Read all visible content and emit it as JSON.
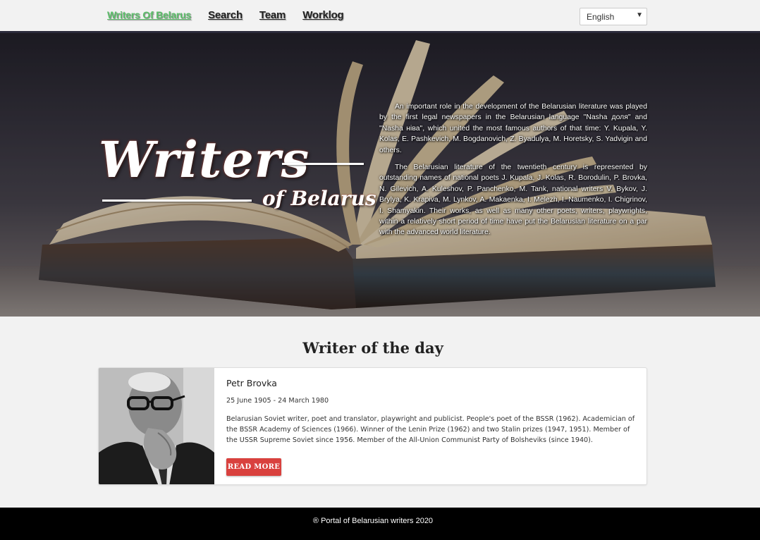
{
  "nav": {
    "brand": "Writers Of Belarus",
    "items": [
      "Search",
      "Team",
      "Worklog"
    ]
  },
  "language": {
    "selected": "English",
    "caret_icon": "chevron-down-icon"
  },
  "hero": {
    "title": "Writers",
    "subtitle": "of Belarus",
    "paragraphs": [
      "An important role in the development of the Belarusian literature was played by the first legal newspapers in the Belarusian language \"Nasha доля\" and \"Nasha нiва\", which united the most famous authors of that time: Y. Kupala, Y. Kolas, E. Pashkevich, M. Bogdanovich, Z. Byadulya, M. Horetsky, S. Yadvigin and others.",
      "The Belarusian literature of the twentieth century is represented by outstanding names of national poets J. Kupala, J. Kolas, R. Borodulin, P. Brovka, N. Gilevich, A. Kuleshov, P. Panchenko, M. Tank, national writers V. Bykov, J. Brylya, K. Krapiva, M. Lynkov, A. Makaenka, I. Melezh, I. Naumenko, I. Chigrinov, I. Shamyakin. Their works, as well as many other poets, writers, playwrights, within a relatively short period of time have put the Belarusian literature on a par with the advanced world literature."
    ]
  },
  "writer_of_day": {
    "section_title": "Writer of the day",
    "name": "Petr Brovka",
    "dates": "25 June 1905 - 24 March 1980",
    "bio": "Belarusian Soviet writer, poet and translator, playwright and publicist. People's poet of the BSSR (1962). Academician of the BSSR Academy of Sciences (1966). Winner of the Lenin Prize (1962) and two Stalin prizes (1947, 1951). Member of the USSR Supreme Soviet since 1956. Member of the All-Union Communist Party of Bolsheviks (since 1940).",
    "read_more_label": "READ MORE"
  },
  "footer": {
    "text": "® Portal of Belarusian writers 2020"
  },
  "colors": {
    "brand_link": "#5cbf6a",
    "read_more_button": "#d9413e",
    "footer_bg": "#000000",
    "header_border": "#2a2a3a"
  }
}
